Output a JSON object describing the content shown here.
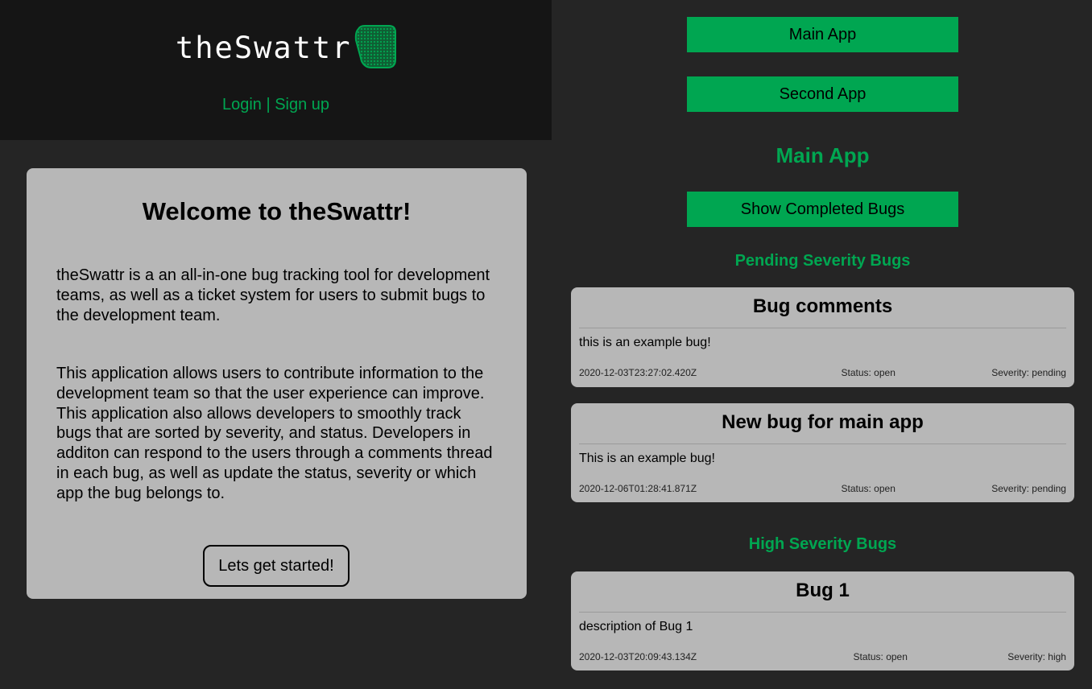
{
  "header": {
    "logo_text": "theSwattr",
    "login_label": "Login",
    "separator": " | ",
    "signup_label": "Sign up"
  },
  "welcome": {
    "title": "Welcome to theSwattr!",
    "paragraph1": "theSwattr is a an all-in-one bug tracking tool for development teams, as well as a ticket system for users to submit bugs to the development team.",
    "paragraph2": "This application allows users to contribute information to the development team so that the user experience can improve. This application also allows developers to smoothly track bugs that are sorted by severity, and status. Developers in additon can respond to the users through a comments thread in each bug, as well as update the status, severity or which app the bug belongs to.",
    "cta_label": "Lets get started!"
  },
  "apps": {
    "main_app_label": "Main App",
    "second_app_label": "Second App"
  },
  "main": {
    "title": "Main App",
    "show_completed_label": "Show Completed Bugs",
    "pending_title": "Pending Severity Bugs",
    "high_title": "High Severity Bugs"
  },
  "bugs": [
    {
      "title": "Bug comments",
      "description": "this is an example bug!",
      "date": "2020-12-03T23:27:02.420Z",
      "status": "Status: open",
      "severity": "Severity: pending"
    },
    {
      "title": "New bug for main app",
      "description": "This is an example bug!",
      "date": "2020-12-06T01:28:41.871Z",
      "status": "Status: open",
      "severity": "Severity: pending"
    },
    {
      "title": "Bug 1",
      "description": "description of Bug 1",
      "date": "2020-12-03T20:09:43.134Z",
      "status": "Status: open",
      "severity": "Severity: high"
    }
  ],
  "colors": {
    "accent": "#00a651",
    "background": "#252525",
    "header_bg": "#151515",
    "card_bg": "#b7b7b7"
  },
  "icons": {
    "logo_mark": "bug-shield-icon"
  }
}
